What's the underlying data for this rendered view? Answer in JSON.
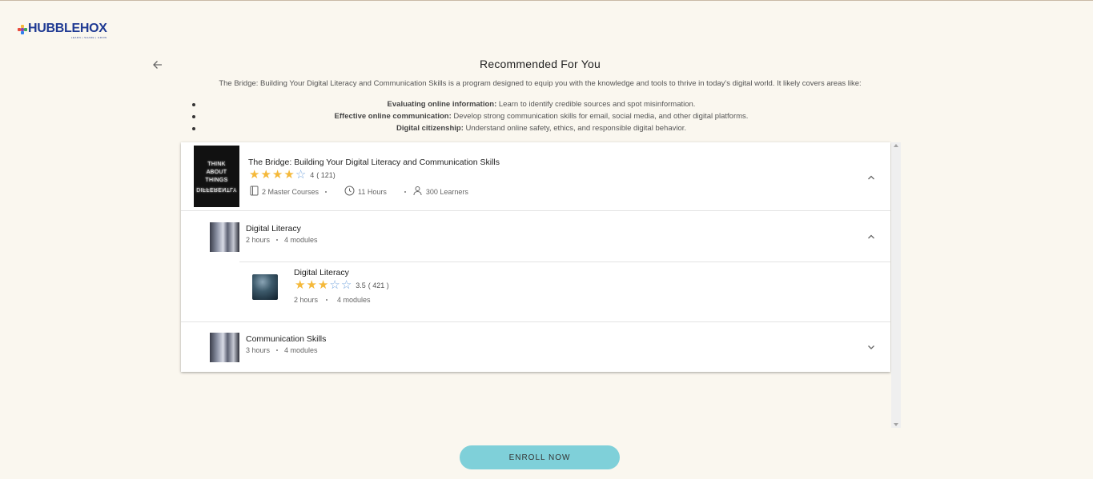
{
  "brand": {
    "name": "HUBBLEHOX",
    "tagline": "LEARN | SHARE | GROW",
    "colors": {
      "navy": "#1f3a93",
      "teal": "#7fd0d9",
      "star": "#f5b93a",
      "star_empty": "#7aa9e0"
    }
  },
  "header": {
    "title": "Recommended For You",
    "back_icon": "arrow-left-icon"
  },
  "intro": {
    "text": "The Bridge: Building Your Digital Literacy and Communication Skills is a program designed to equip you with the knowledge and tools to thrive in today's digital world. It likely covers areas like:",
    "bullets": [
      {
        "term": "Evaluating online information:",
        "desc": " Learn to identify credible sources and spot misinformation."
      },
      {
        "term": "Effective online communication:",
        "desc": " Develop strong communication skills for email, social media, and other digital platforms."
      },
      {
        "term": "Digital citizenship:",
        "desc": " Understand online safety, ethics, and responsible digital behavior."
      }
    ]
  },
  "program": {
    "title": "The Bridge: Building Your Digital Literacy and Communication Skills",
    "rating": "4",
    "reviews": "( 121)",
    "courses": "2 Master Courses",
    "duration": "11 Hours",
    "learners": "300 Learners",
    "thumb_lines": [
      "THINK",
      "ABOUT",
      "THINGS",
      "DIFFERENTLY"
    ]
  },
  "courses": [
    {
      "title": "Digital Literacy",
      "hours": "2 hours",
      "modules": "4 modules",
      "expanded": true,
      "items": [
        {
          "title": "Digital Literacy",
          "rating": "3.5",
          "reviews": "( 421 )",
          "hours": "2 hours",
          "modules": "4 modules"
        }
      ]
    },
    {
      "title": "Communication Skills",
      "hours": "3 hours",
      "modules": "4 modules",
      "expanded": false
    }
  ],
  "enroll_label": "ENROLL NOW"
}
